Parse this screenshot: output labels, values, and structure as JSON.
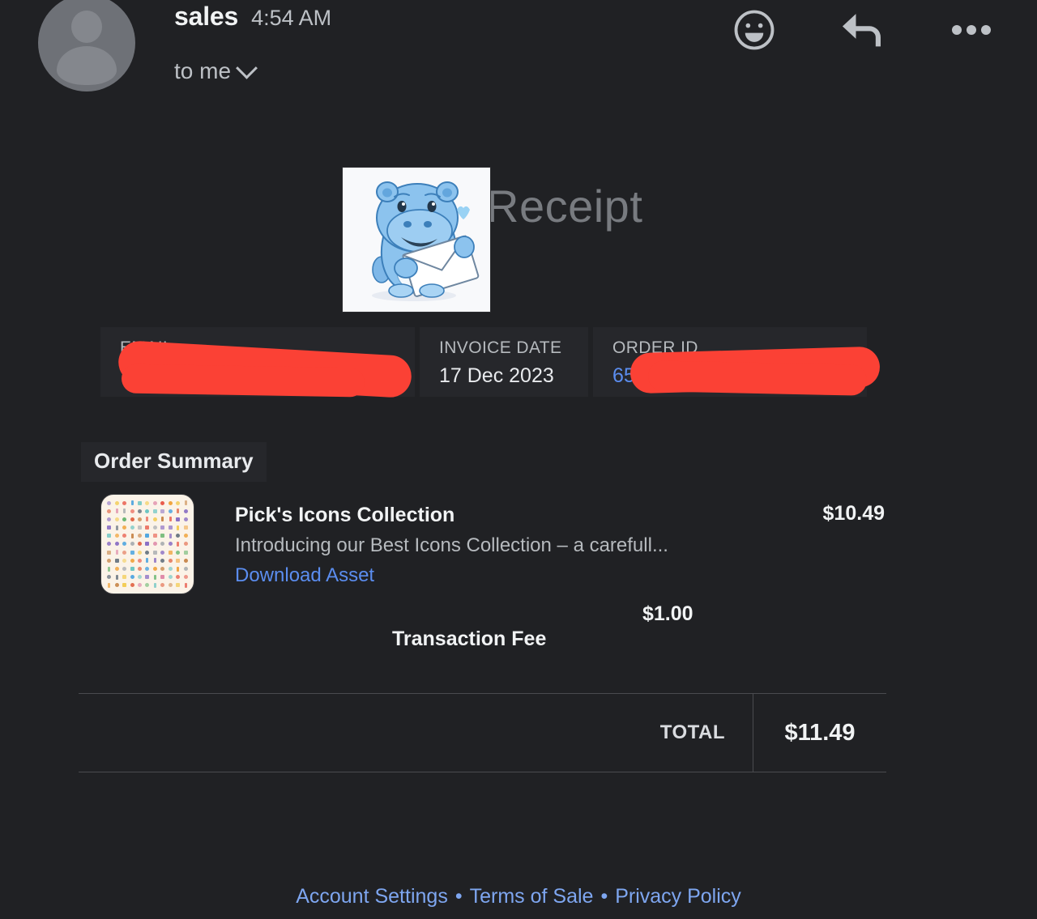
{
  "email_header": {
    "sender": "sales",
    "time": "4:54 AM",
    "recipient": "to me",
    "avatar_icon": "person-avatar-icon",
    "actions": [
      {
        "name": "emoji-reaction-icon",
        "label": "Add reaction"
      },
      {
        "name": "reply-icon",
        "label": "Reply"
      },
      {
        "name": "more-options-icon",
        "label": "More"
      }
    ]
  },
  "receipt": {
    "banner_word": "Receipt",
    "hero_image_alt": "blue-hippo-with-envelope-illustration",
    "info": [
      {
        "label": "EMAIL",
        "value": "",
        "redacted": true,
        "is_link": false
      },
      {
        "label": "INVOICE DATE",
        "value": "17 Dec 2023",
        "redacted": false,
        "is_link": false
      },
      {
        "label": "ORDER ID",
        "value": "65",
        "redacted": true,
        "is_link": true
      }
    ],
    "summary_title": "Order Summary",
    "line_item": {
      "thumb_alt": "icons-collection-thumbnail",
      "title": "Pick's Icons Collection",
      "description": "Introducing our Best Icons Collection – a carefull...",
      "link_label": "Download Asset",
      "price": "$10.49"
    },
    "fee": {
      "price": "$1.00",
      "label": "Transaction Fee"
    },
    "total": {
      "label": "TOTAL",
      "value": "$11.49"
    },
    "footer_links": [
      "Account Settings",
      "Terms of Sale",
      "Privacy Policy"
    ],
    "footer_separator": "•"
  },
  "colors": {
    "page_background": "#202124",
    "panel_background": "#26272b",
    "link_blue": "#5b8def",
    "footer_link_blue": "#7ea6f0",
    "redaction_red": "#fb4135",
    "text_primary": "#f1f3f4",
    "text_secondary": "#b6babe"
  }
}
